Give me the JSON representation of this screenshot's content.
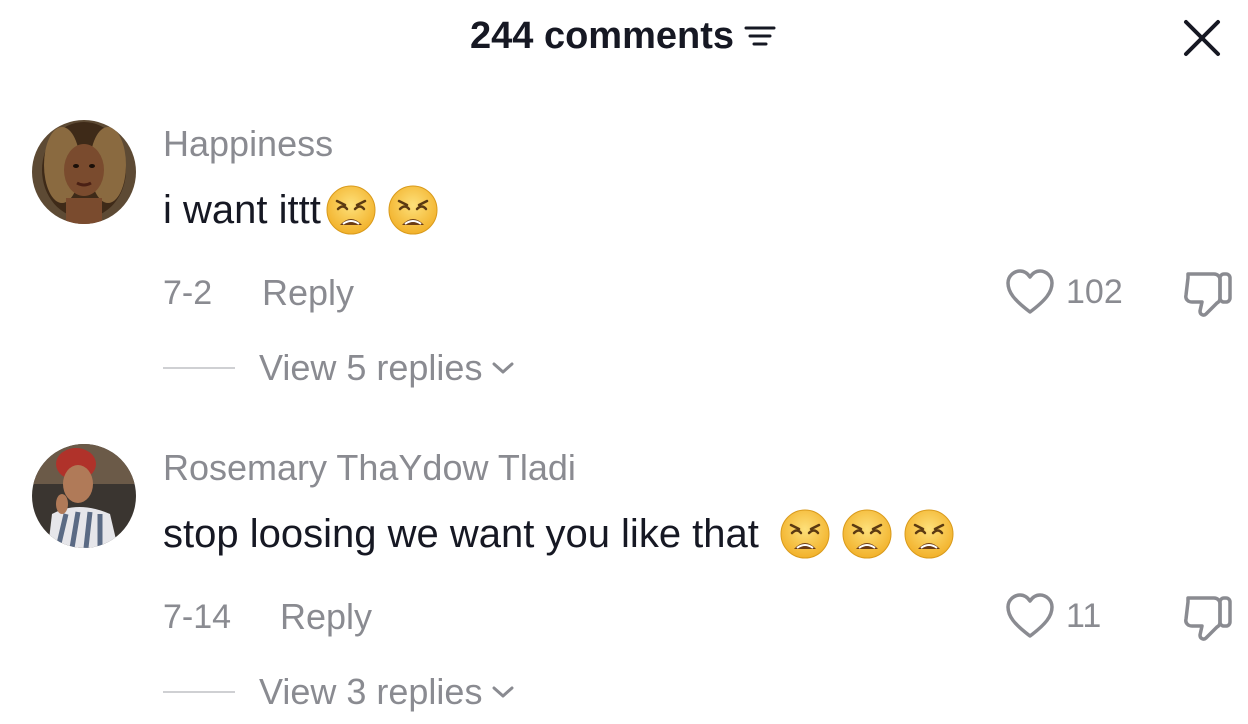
{
  "header": {
    "title": "244 comments",
    "sort_icon": "sort-lines-icon",
    "close_icon": "close-icon"
  },
  "comments": [
    {
      "username": "Happiness",
      "text": "i want ittt",
      "emojis": [
        "weary-face",
        "weary-face"
      ],
      "date": "7-2",
      "reply_label": "Reply",
      "likes": "102",
      "view_replies": "View 5 replies"
    },
    {
      "username": "Rosemary ThaYdow Tladi",
      "text": "stop loosing we want you like that",
      "emojis": [
        "weary-face",
        "weary-face",
        "weary-face"
      ],
      "date": "7-14",
      "reply_label": "Reply",
      "likes": "11",
      "view_replies": "View 3 replies"
    }
  ],
  "colors": {
    "primary_text": "#161823",
    "secondary_text": "#8a8b91",
    "emoji_yellow": "#f7c23b"
  }
}
